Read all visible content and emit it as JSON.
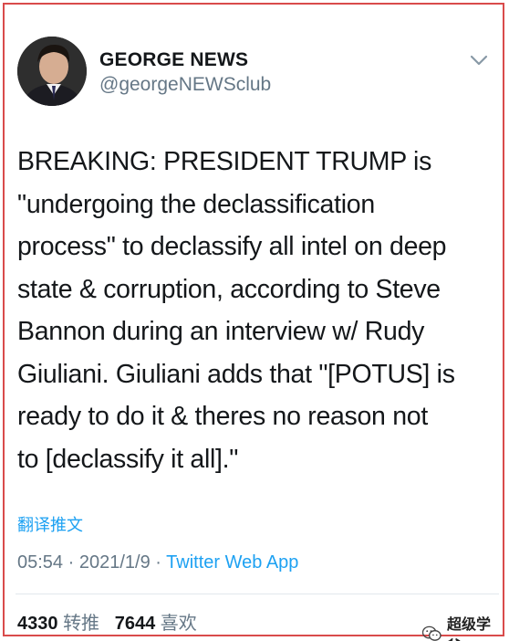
{
  "author": {
    "display_name": "GEORGE NEWS",
    "handle": "@georgeNEWSclub",
    "avatar_icon": "profile-photo"
  },
  "menu_icon": "chevron-down-icon",
  "tweet": {
    "text": "BREAKING: PRESIDENT TRUMP is\n\"undergoing the declassification\nprocess\" to declassify all intel on deep\nstate & corruption, according to Steve\nBannon during an interview w/ Rudy\nGiuliani. Giuliani adds that \"[POTUS] is\nready to do it & theres no reason not\nto [declassify it all].\"",
    "translate_label": "翻译推文",
    "time": "05:54",
    "date": "2021/1/9",
    "separator": "·",
    "source_app": "Twitter Web App"
  },
  "stats": {
    "retweets_count": "4330",
    "retweets_label": "转推",
    "likes_count": "7644",
    "likes_label": "喜欢"
  },
  "watermark": {
    "text": "超级学爸",
    "icon": "wechat-icon"
  },
  "colors": {
    "accent": "#1da1f2",
    "muted": "#657786",
    "text": "#14171a",
    "frame_border": "#d94b4b"
  }
}
